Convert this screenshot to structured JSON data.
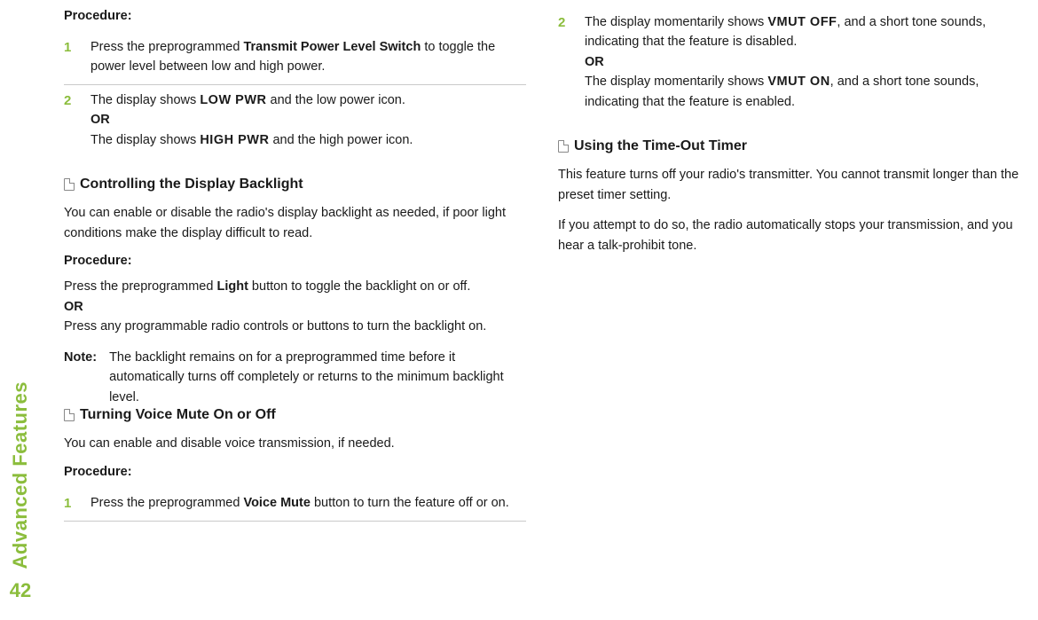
{
  "sidebar": {
    "label": "Advanced Features",
    "page": "42"
  },
  "labels": {
    "procedure": "Procedure:",
    "or": "OR",
    "note": "Note:"
  },
  "left": {
    "step1": {
      "num": "1",
      "a": "Press the preprogrammed ",
      "b": "Transmit Power Level Switch",
      "c": " to toggle the power level between low and high power."
    },
    "step2": {
      "num": "2",
      "a": "The display shows ",
      "b": "LOW PWR",
      "c": " and the low power icon.",
      "d": "The display shows ",
      "e": "HIGH PWR",
      "f": " and the high power icon."
    },
    "section_backlight": "Controlling the Display Backlight",
    "backlight_intro": "You can enable or disable the radio's display backlight as needed, if poor light conditions make the display difficult to read.",
    "backlight_p1a": "Press the preprogrammed ",
    "backlight_p1b": "Light",
    "backlight_p1c": " button to toggle the backlight on or off.",
    "backlight_p2": "Press any programmable radio controls or buttons to turn the backlight on.",
    "backlight_note": "The backlight remains on for a preprogrammed time before it automatically turns off completely or returns to the minimum backlight level."
  },
  "right": {
    "section_voice": "Turning Voice Mute On or Off",
    "voice_intro": "You can enable and disable voice transmission, if needed.",
    "voice_step1": {
      "num": "1",
      "a": "Press the preprogrammed ",
      "b": "Voice Mute",
      "c": " button to turn the feature off or on."
    },
    "voice_step2": {
      "num": "2",
      "a": "The display momentarily shows ",
      "b": "VMUT OFF",
      "c": ", and a short tone sounds, indicating that the feature is disabled.",
      "d": "The display momentarily shows ",
      "e": "VMUT ON",
      "f": ", and a short tone sounds, indicating that the feature is enabled."
    },
    "section_timer": "Using the Time-Out Timer",
    "timer_p1": "This feature turns off your radio's transmitter. You cannot transmit longer than the preset timer setting.",
    "timer_p2": "If you attempt to do so, the radio automatically stops your transmission, and you hear a talk-prohibit tone."
  }
}
